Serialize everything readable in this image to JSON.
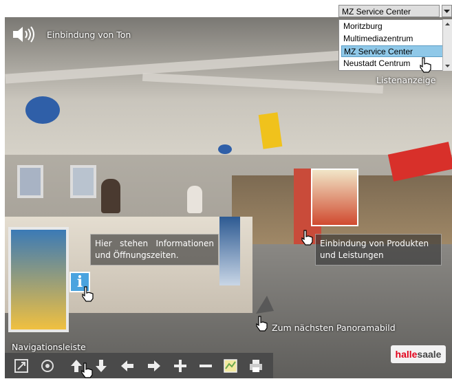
{
  "sound": {
    "label": "Einbindung von Ton",
    "icon": "speaker-icon"
  },
  "dropdown": {
    "selected": "MZ Service Center",
    "items": [
      "Moritzburg",
      "Multimediazentrum",
      "MZ Service Center",
      "Neustadt Centrum"
    ],
    "caption": "Listenanzeige"
  },
  "info_hotspot": {
    "text": "Hier stehen Informationen und Öffnungszeiten.",
    "icon_glyph": "i"
  },
  "product_hotspot": {
    "text": "Einbindung von Produkten und Leistungen"
  },
  "next_panorama": {
    "text": "Zum nächsten Panoramabild"
  },
  "navbar": {
    "caption": "Navigationsleiste",
    "buttons": [
      "fullscreen-icon",
      "rotate-icon",
      "arrow-up-icon",
      "arrow-down-icon",
      "arrow-left-icon",
      "arrow-right-icon",
      "zoom-in-icon",
      "zoom-out-icon",
      "map-icon",
      "print-icon"
    ]
  },
  "logo": {
    "text_a": "halle",
    "text_b": "saale"
  },
  "colors": {
    "selected_item": "#8fc8e8",
    "navbar": "#4a4a4a",
    "info_icon": "#4aa3df"
  }
}
